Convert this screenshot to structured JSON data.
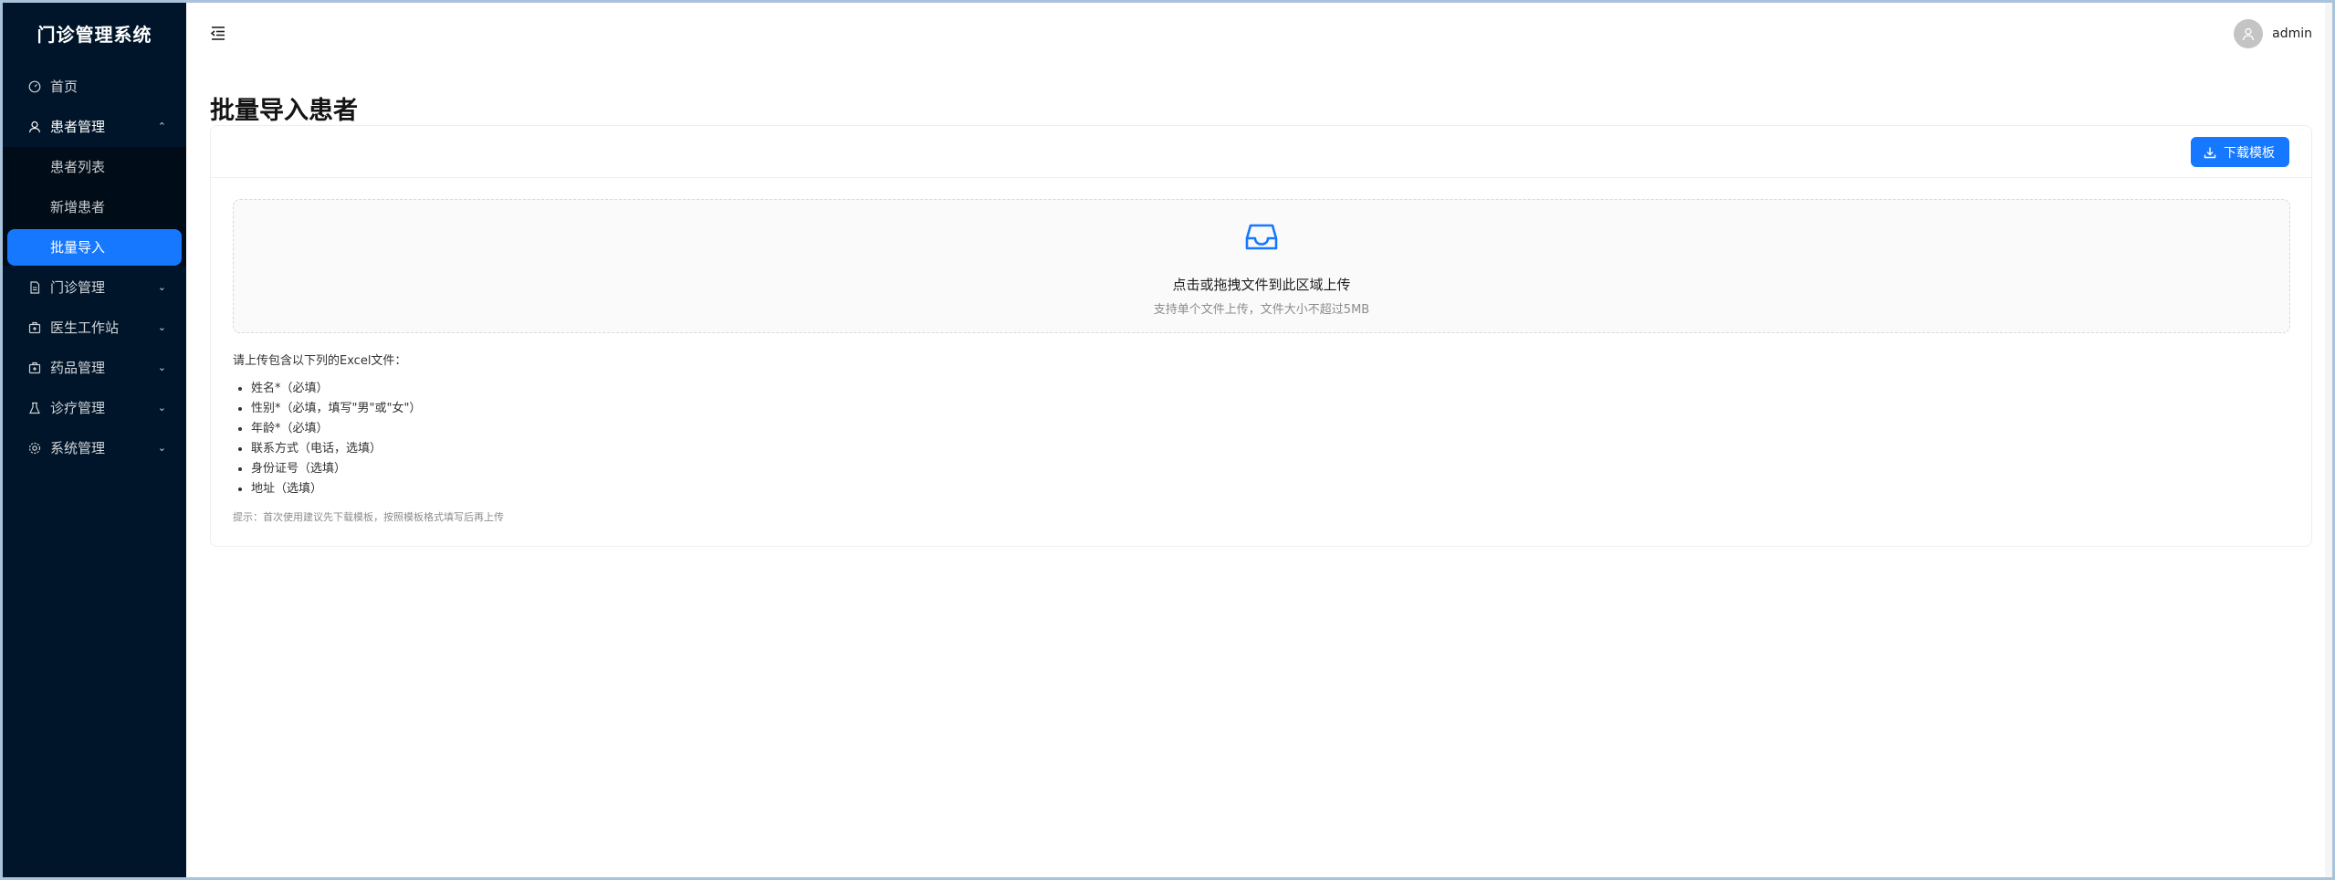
{
  "app": {
    "title": "门诊管理系统"
  },
  "sidebar": {
    "items": [
      {
        "label": "首页",
        "icon": "dashboard-icon"
      },
      {
        "label": "患者管理",
        "icon": "user-icon",
        "open": true,
        "children": [
          {
            "label": "患者列表"
          },
          {
            "label": "新增患者"
          },
          {
            "label": "批量导入",
            "active": true
          }
        ]
      },
      {
        "label": "门诊管理",
        "icon": "file-icon"
      },
      {
        "label": "医生工作站",
        "icon": "medicine-box-icon"
      },
      {
        "label": "药品管理",
        "icon": "medicine-box-icon"
      },
      {
        "label": "诊疗管理",
        "icon": "experiment-icon"
      },
      {
        "label": "系统管理",
        "icon": "setting-icon"
      }
    ]
  },
  "header": {
    "username": "admin"
  },
  "page": {
    "title": "批量导入患者",
    "download_button": "下载模板",
    "dropzone": {
      "text": "点击或拖拽文件到此区域上传",
      "hint": "支持单个文件上传，文件大小不超过5MB"
    },
    "instructions": {
      "intro": "请上传包含以下列的Excel文件：",
      "fields": [
        "姓名*（必填）",
        "性别*（必填，填写\"男\"或\"女\"）",
        "年龄*（必填）",
        "联系方式（电话，选填）",
        "身份证号（选填）",
        "地址（选填）"
      ]
    },
    "tip": "提示：首次使用建议先下载模板，按照模板格式填写后再上传"
  },
  "colors": {
    "sidebar_bg": "#001529",
    "submenu_bg": "#000c17",
    "primary": "#1677ff"
  }
}
